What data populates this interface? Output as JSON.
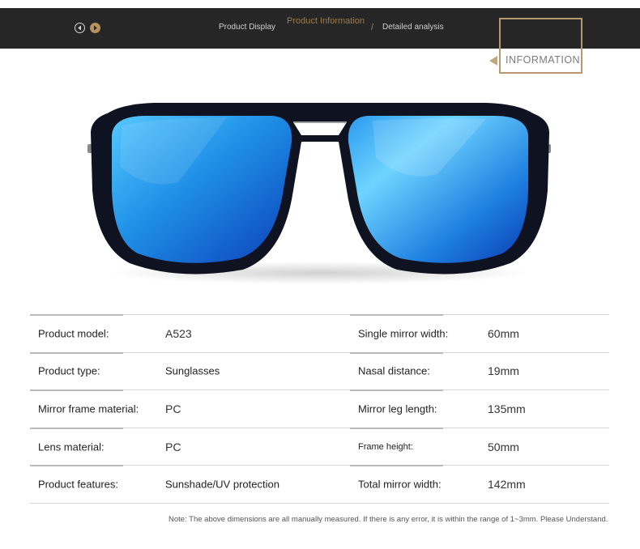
{
  "header": {
    "tab_left": "Product Display",
    "tab_center": "Product Information",
    "tab_slash": "/",
    "tab_right": "Detailed analysis"
  },
  "badge": {
    "label": "INFORMATION"
  },
  "specs": [
    {
      "label": "Product model:",
      "value": "A523",
      "label2": "Single mirror width:",
      "value2": "60mm"
    },
    {
      "label": "Product type:",
      "value": "Sunglasses",
      "label2": "Nasal distance:",
      "value2": "19mm"
    },
    {
      "label": "Mirror frame material:",
      "value": "PC",
      "label2": "Mirror leg length:",
      "value2": "135mm"
    },
    {
      "label": "Lens material:",
      "value": "PC",
      "label2": "Frame height:",
      "value2": "50mm"
    },
    {
      "label": "Product features:",
      "value": "Sunshade/UV protection",
      "label2": "Total mirror width:",
      "value2": "142mm"
    }
  ],
  "note": "Note: The above dimensions are all manually measured. If there is any error, it is within the range of 1~3mm. Please Understand.",
  "colors": {
    "header_bg": "#262626",
    "accent_gold": "#b49a6e",
    "lens_blue": "#1e8fe6",
    "frame": "#0f1220"
  }
}
